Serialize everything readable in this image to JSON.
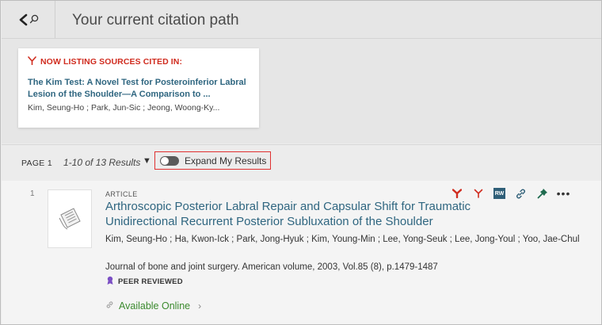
{
  "header": {
    "title": "Your current citation path"
  },
  "citation_card": {
    "heading": "NOW LISTING SOURCES CITED IN:",
    "title": "The Kim Test: A Novel Test for Posteroinferior Labral Lesion of the Shoulder—A Comparison to ...",
    "authors": "Kim, Seung-Ho ; Park, Jun-Sic ; Jeong, Woong-Ky..."
  },
  "results_bar": {
    "page_label": "PAGE 1",
    "count": "1-10 of 13 Results",
    "caret": "▼",
    "expand_label": "Expand My Results",
    "expand_enabled": false
  },
  "result": {
    "number": "1",
    "type": "ARTICLE",
    "title": "Arthroscopic Posterior Labral Repair and Capsular Shift for Traumatic Unidirectional Recurrent Posterior Subluxation of the Shoulder",
    "authors": "Kim, Seung-Ho ; Ha, Kwon-Ick ; Park, Jong-Hyuk ; Kim, Young-Min ; Lee, Yong-Seuk ; Lee, Jong-Youl ; Yoo, Jae-Chul",
    "source": "Journal of bone and joint surgery. American volume, 2003, Vol.85 (8), p.1479-1487",
    "peer_reviewed": "PEER REVIEWED",
    "availability": "Available Online",
    "availability_chevron": "›",
    "actions": {
      "rw_label": "RW",
      "more_label": "•••"
    }
  },
  "colors": {
    "accent_red": "#d02c1f",
    "link_blue": "#2f6680",
    "online_green": "#3b8a2e",
    "highlight_box": "#e03131",
    "peer_purple": "#7b4fc4"
  },
  "icons": {
    "back": "chevron-left-icon",
    "search": "search-icon",
    "citation_trail": "citation-trail-icon",
    "cited_by": "cited-by-icon",
    "citing": "citing-icon",
    "rw": "researcher-workspace-icon",
    "link": "link-icon",
    "pin": "pin-icon",
    "more": "more-options-icon",
    "peer": "peer-reviewed-icon",
    "online_link": "link-icon"
  }
}
